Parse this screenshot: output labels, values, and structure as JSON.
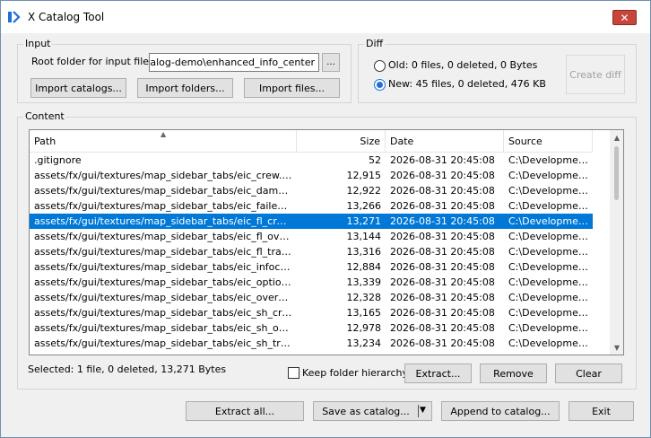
{
  "window": {
    "title": "X Catalog Tool",
    "close_glyph": "✕"
  },
  "input_group": {
    "legend": "Input",
    "root_label": "Root folder for input files:",
    "root_value": "\\catalog-demo\\enhanced_info_center",
    "browse_label": "...",
    "import_catalogs": "Import catalogs...",
    "import_folders": "Import folders...",
    "import_files": "Import files..."
  },
  "diff_group": {
    "legend": "Diff",
    "old_label": "Old: 0 files, 0 deleted, 0 Bytes",
    "new_label": "New: 45 files, 0 deleted, 476 KB",
    "create_diff": "Create diff",
    "selected": "new"
  },
  "content_group": {
    "legend": "Content",
    "columns": [
      "Path",
      "Size",
      "Date",
      "Source"
    ],
    "rows": [
      {
        "path": ".gitignore",
        "size": "52",
        "date": "2026-08-31 20:45:08",
        "source": "C:\\Developmen..."
      },
      {
        "path": "assets/fx/gui/textures/map_sidebar_tabs/eic_crew.gz",
        "size": "12,915",
        "date": "2026-08-31 20:45:08",
        "source": "C:\\Developmen..."
      },
      {
        "path": "assets/fx/gui/textures/map_sidebar_tabs/eic_damaged.gz",
        "size": "12,922",
        "date": "2026-08-31 20:45:08",
        "source": "C:\\Developmen..."
      },
      {
        "path": "assets/fx/gui/textures/map_sidebar_tabs/eic_failed.gz",
        "size": "13,266",
        "date": "2026-08-31 20:45:08",
        "source": "C:\\Developmen..."
      },
      {
        "path": "assets/fx/gui/textures/map_sidebar_tabs/eic_fl_crew.gz",
        "size": "13,271",
        "date": "2026-08-31 20:45:08",
        "source": "C:\\Developmen...",
        "selected": true
      },
      {
        "path": "assets/fx/gui/textures/map_sidebar_tabs/eic_fl_overvie...",
        "size": "13,144",
        "date": "2026-08-31 20:45:08",
        "source": "C:\\Developmen..."
      },
      {
        "path": "assets/fx/gui/textures/map_sidebar_tabs/eic_fl_trade.gz",
        "size": "13,316",
        "date": "2026-08-31 20:45:08",
        "source": "C:\\Developmen..."
      },
      {
        "path": "assets/fx/gui/textures/map_sidebar_tabs/eic_infocenter.gz",
        "size": "12,884",
        "date": "2026-08-31 20:45:08",
        "source": "C:\\Developmen..."
      },
      {
        "path": "assets/fx/gui/textures/map_sidebar_tabs/eic_options.gz",
        "size": "13,339",
        "date": "2026-08-31 20:45:08",
        "source": "C:\\Developmen..."
      },
      {
        "path": "assets/fx/gui/textures/map_sidebar_tabs/eic_overview.gz",
        "size": "12,328",
        "date": "2026-08-31 20:45:08",
        "source": "C:\\Developmen..."
      },
      {
        "path": "assets/fx/gui/textures/map_sidebar_tabs/eic_sh_crew.gz",
        "size": "13,165",
        "date": "2026-08-31 20:45:08",
        "source": "C:\\Developmen..."
      },
      {
        "path": "assets/fx/gui/textures/map_sidebar_tabs/eic_sh_overvie...",
        "size": "12,978",
        "date": "2026-08-31 20:45:08",
        "source": "C:\\Developmen..."
      },
      {
        "path": "assets/fx/gui/textures/map_sidebar_tabs/eic_sh_trade.gz",
        "size": "13,234",
        "date": "2026-08-31 20:45:08",
        "source": "C:\\Developmen..."
      }
    ],
    "status": "Selected: 1 file, 0 deleted, 13,271 Bytes",
    "keep_hierarchy": "Keep folder hierarchy",
    "extract": "Extract...",
    "remove": "Remove",
    "clear": "Clear"
  },
  "footer": {
    "extract_all": "Extract all...",
    "save_as_catalog": "Save as catalog...",
    "append_to_catalog": "Append to catalog...",
    "exit": "Exit"
  },
  "colors": {
    "selection": "#0078d7",
    "close": "#c7463c"
  }
}
